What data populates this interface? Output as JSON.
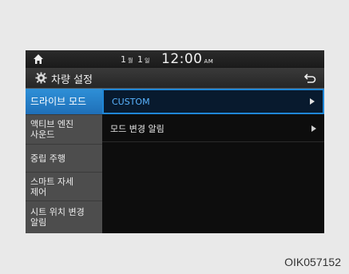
{
  "status": {
    "day1": "1",
    "day1_unit": "월",
    "day2": "1",
    "day2_unit": "일",
    "time": "12:00",
    "ampm": "AM"
  },
  "header": {
    "title": "차량 설정"
  },
  "sidebar": {
    "items": [
      {
        "label": "드라이브 모드"
      },
      {
        "label": "액티브 엔진\n사운드"
      },
      {
        "label": "중립 주행"
      },
      {
        "label": "스마트 자세\n제어"
      },
      {
        "label": "시트 위치 변경\n알림"
      }
    ]
  },
  "main": {
    "rows": [
      {
        "label": "CUSTOM"
      },
      {
        "label": "모드 변경 알림"
      }
    ]
  },
  "caption": "OIK057152",
  "colors": {
    "accent": "#1f86d6",
    "active_bg": "#2a85cf",
    "selected_text": "#5ab4ff"
  }
}
